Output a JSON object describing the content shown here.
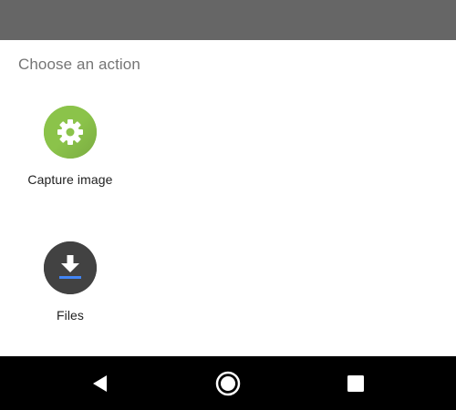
{
  "sheet": {
    "title": "Choose an action",
    "actions": [
      {
        "label": "Capture image",
        "icon": "settings-gear-icon",
        "color": "#8BC34A"
      },
      {
        "label": "Files",
        "icon": "download-icon",
        "color": "#424242",
        "accent": "#4285F4"
      }
    ]
  },
  "navbar": {
    "buttons": [
      "back-icon",
      "home-icon",
      "recents-icon"
    ]
  }
}
